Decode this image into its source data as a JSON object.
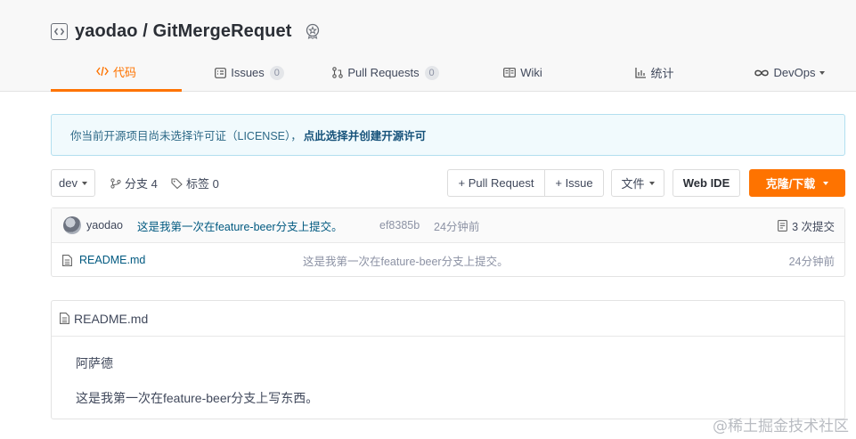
{
  "repo": {
    "title": "yaodao / GitMergeRequet"
  },
  "tabs": [
    {
      "label": "代码",
      "icon": "code-icon",
      "active": true
    },
    {
      "label": "Issues",
      "icon": "issues-icon",
      "count": "0"
    },
    {
      "label": "Pull Requests",
      "icon": "pull-request-icon",
      "count": "0"
    },
    {
      "label": "Wiki",
      "icon": "wiki-icon"
    },
    {
      "label": "统计",
      "icon": "chart-icon"
    },
    {
      "label": "DevOps",
      "icon": "infinity-icon"
    }
  ],
  "notice": {
    "text": "你当前开源项目尚未选择许可证（LICENSE），",
    "link": "点此选择并创建开源许可"
  },
  "toolbar": {
    "branch": "dev",
    "branches": "分支 4",
    "tags": "标签 0",
    "new_pr": "+ Pull Request",
    "new_issue": "+ Issue",
    "files": "文件",
    "web_ide": "Web IDE",
    "clone": "克隆/下载"
  },
  "last_commit": {
    "author": "yaodao",
    "message": "这是我第一次在feature-beer分支上提交。",
    "hash": "ef8385b",
    "time": "24分钟前",
    "commits": "3 次提交"
  },
  "files": [
    {
      "name": "README.md",
      "message": "这是我第一次在feature-beer分支上提交。",
      "time": "24分钟前"
    }
  ],
  "readme": {
    "title": "README.md",
    "lines": [
      "阿萨德",
      "这是我第一次在feature-beer分支上写东西。"
    ]
  },
  "colors": {
    "accent": "#fe7300",
    "link": "#005980",
    "notice_bg": "#f1fafd"
  },
  "watermark": "@稀土掘金技术社区"
}
